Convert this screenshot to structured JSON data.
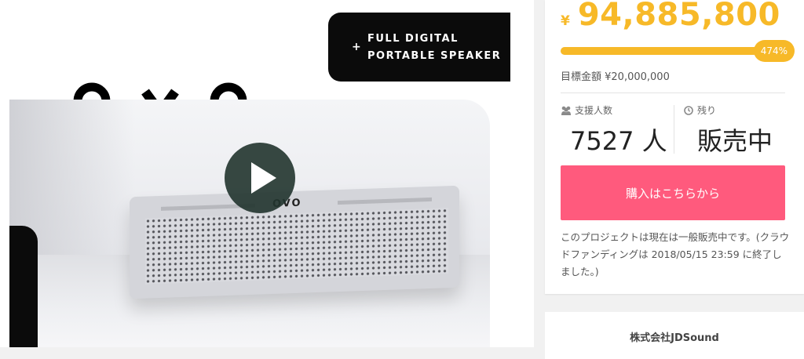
{
  "media": {
    "title_line1": "FULL DIGITAL",
    "title_line2": "PORTABLE SPEAKER",
    "plus": "+",
    "brand_glyphs": [
      "O",
      "V",
      "O"
    ],
    "speaker_logo": "OVO",
    "play_icon": "play-icon"
  },
  "funding": {
    "currency_symbol": "¥",
    "amount": "94,885,800",
    "percent": "474%",
    "progress_fraction": 1.0,
    "goal_label": "目標金額 ¥20,000,000",
    "supporters_label": "支援人数",
    "supporters_value": "7527 人",
    "remaining_label": "残り",
    "remaining_value": "販売中",
    "buy_label": "購入はこちらから",
    "notice": "このプロジェクトは現在は一般販売中です。(クラウドファンディングは 2018/05/15 23:59 に終了しました。)"
  },
  "company": {
    "name": "株式会社JDSound"
  },
  "colors": {
    "accent_yellow": "#f7b928",
    "buy_pink": "#ff5a7d"
  }
}
